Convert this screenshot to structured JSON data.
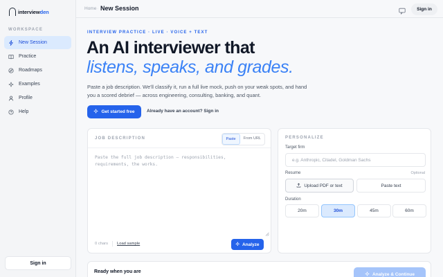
{
  "app": {
    "logo_prefix": "interview",
    "logo_suffix": "den"
  },
  "sidebar": {
    "section_label": "WORKSPACE",
    "items": [
      {
        "label": "New Session",
        "icon": "bolt-icon",
        "active": true
      },
      {
        "label": "Practice",
        "icon": "book-icon",
        "active": false
      },
      {
        "label": "Roadmaps",
        "icon": "compass-icon",
        "active": false
      },
      {
        "label": "Examples",
        "icon": "sparkle-icon",
        "active": false
      },
      {
        "label": "Profile",
        "icon": "user-icon",
        "active": false
      },
      {
        "label": "Help",
        "icon": "help-icon",
        "active": false
      }
    ],
    "signin_label": "Sign in"
  },
  "topbar": {
    "breadcrumb_home": "Home",
    "breadcrumb_sep": "·",
    "page_title": "New Session",
    "signin_label": "Sign in"
  },
  "hero": {
    "eyebrow": "INTERVIEW PRACTICE · LIVE · VOICE + TEXT",
    "title_line1": "An AI interviewer that",
    "title_line2": "listens, speaks, and grades.",
    "lede": "Paste a job description. We'll classify it, run a full live mock, push on your weak spots, and hand you a scored debrief — across engineering, consulting, banking, and quant.",
    "cta_label": "Get started free",
    "have_account": "Already have an account? Sign in"
  },
  "job_description": {
    "label": "JOB DESCRIPTION",
    "tabs": [
      {
        "label": "Paste",
        "active": true
      },
      {
        "label": "From URL",
        "active": false
      }
    ],
    "placeholder_line1": "Paste the full job description — responsibilities,",
    "placeholder_line2": "requirements, the works.",
    "char_count": "0 chars",
    "load_sample": "Load sample",
    "analyze_label": "Analyze"
  },
  "personalize": {
    "label": "PERSONALIZE",
    "target_firm_label": "Target firm",
    "target_firm_placeholder": "e.g. Anthropic, Citadel, Goldman Sachs",
    "resume_label": "Resume",
    "resume_optional": "Optional",
    "upload_label": "Upload PDF or text",
    "paste_text_label": "Paste text",
    "duration_label": "Duration",
    "durations": [
      {
        "label": "20m",
        "active": false
      },
      {
        "label": "30m",
        "active": true
      },
      {
        "label": "45m",
        "active": false
      },
      {
        "label": "60m",
        "active": false
      }
    ]
  },
  "footer_bar": {
    "ready_text": "Ready when you are",
    "continue_label": "Analyze & Continue"
  },
  "colors": {
    "accent": "#2563eb",
    "accent_light": "#3b82f6",
    "active_bg": "#dbeafe",
    "disabled_accent": "#a5c4fa"
  }
}
